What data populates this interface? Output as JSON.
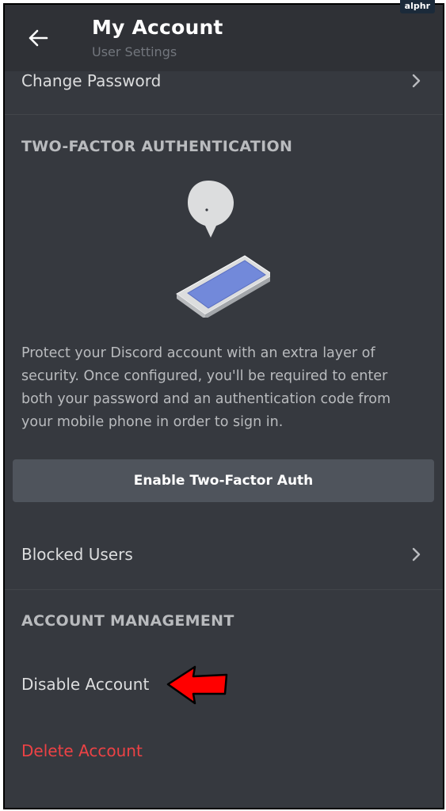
{
  "watermark": "alphr",
  "header": {
    "title": "My Account",
    "subtitle": "User Settings",
    "back_icon": "arrow-left-icon"
  },
  "rows": {
    "change_password": "Change Password",
    "blocked_users": "Blocked Users",
    "disable_account": "Disable Account",
    "delete_account": "Delete Account"
  },
  "two_factor": {
    "heading": "TWO-FACTOR AUTHENTICATION",
    "description": "Protect your Discord account with an extra layer of security. Once configured, you'll be required to enter both your password and an authentication code from your mobile phone in order to sign in.",
    "button_label": "Enable Two-Factor Auth",
    "illustration_icon": "phone-with-speech-bubble-icon"
  },
  "account_management": {
    "heading": "ACCOUNT MANAGEMENT"
  },
  "annotation": {
    "icon": "red-arrow-pointer-icon"
  },
  "colors": {
    "background": "#36393f",
    "header_background": "#2f3136",
    "button_background": "#4f545c",
    "danger": "#ed4245",
    "annotation_arrow": "#ff0000"
  }
}
